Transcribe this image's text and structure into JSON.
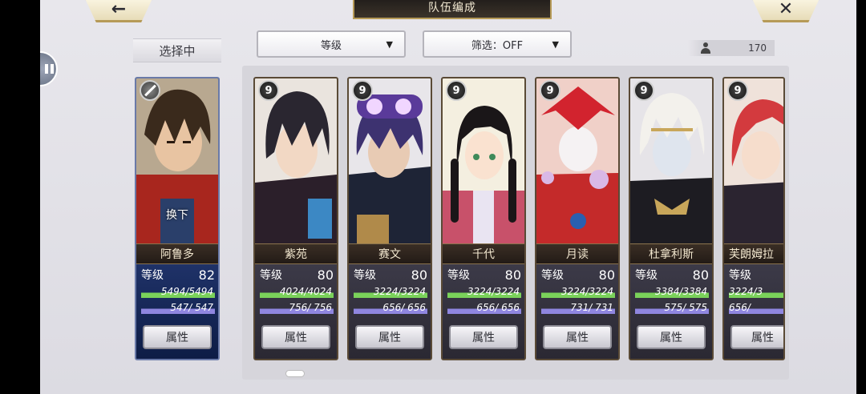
{
  "header": {
    "title": "队伍编成",
    "back_icon": "←",
    "close_icon": "✕"
  },
  "selecting_label": "选择中",
  "sort_dropdown": {
    "value": "等级"
  },
  "filter_dropdown": {
    "value": "筛选：OFF"
  },
  "unit_count": "170",
  "selected": {
    "name": "阿鲁多",
    "level_label": "等级",
    "level": "82",
    "hp": "5494/5494",
    "mp": " 547/  547",
    "swap_label": "换下",
    "attr_label": "属性"
  },
  "units": [
    {
      "name": "紫苑",
      "level_label": "等级",
      "level": "80",
      "hp": "4024/4024",
      "mp": " 756/  756",
      "attr_label": "属性",
      "rank": "9"
    },
    {
      "name": "赛文",
      "level_label": "等级",
      "level": "80",
      "hp": "3224/3224",
      "mp": " 656/  656",
      "attr_label": "属性",
      "rank": "9"
    },
    {
      "name": "千代",
      "level_label": "等级",
      "level": "80",
      "hp": "3224/3224",
      "mp": " 656/  656",
      "attr_label": "属性",
      "rank": "9"
    },
    {
      "name": "月读",
      "level_label": "等级",
      "level": "80",
      "hp": "3224/3224",
      "mp": " 731/  731",
      "attr_label": "属性",
      "rank": "9"
    },
    {
      "name": "杜拿利斯",
      "level_label": "等级",
      "level": "80",
      "hp": "3384/3384",
      "mp": " 575/  575",
      "attr_label": "属性",
      "rank": "9"
    },
    {
      "name": "芙朗姆拉",
      "level_label": "等级",
      "level": "",
      "hp": "3224/3",
      "mp": " 656/",
      "attr_label": "属性",
      "rank": "9"
    }
  ],
  "colors": {
    "hp_bar": "#7ad25a",
    "mp_bar": "#8f86e0",
    "frame_gold": "#b69a57"
  }
}
